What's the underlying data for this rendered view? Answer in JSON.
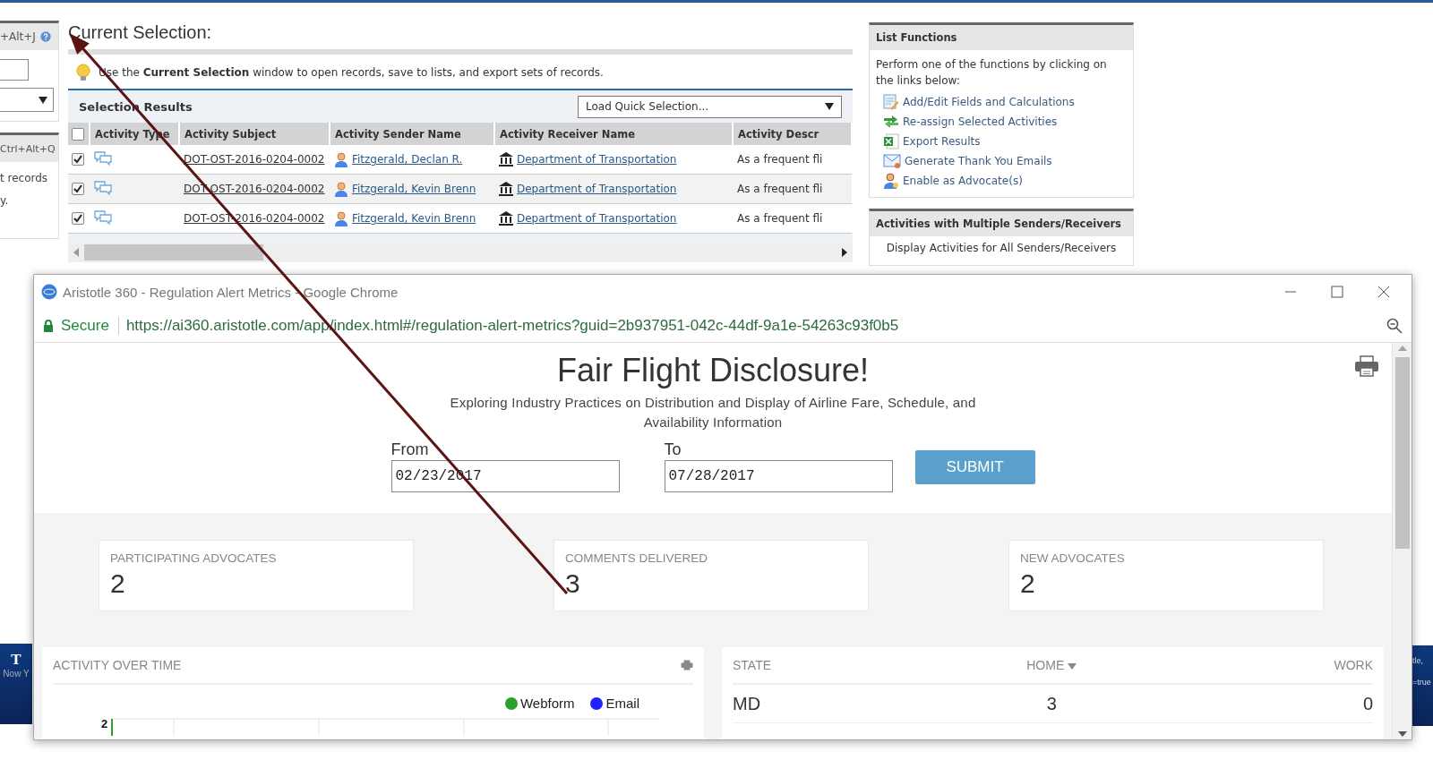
{
  "background_page": {
    "left_panel": {
      "shortcut_1": "+Alt+J",
      "shortcut_2": "Ctrl+Alt+Q",
      "text_lines": [
        "t records",
        "y."
      ]
    },
    "current_selection": {
      "title": "Current Selection:",
      "hint": "Use the **Current Selection** window to open records, save to lists, and export sets of records.",
      "results_title": "Selection Results",
      "quick_selection": "Load Quick Selection...",
      "select_all_checked": false,
      "columns": [
        "Activity Type",
        "Activity Subject",
        "Activity Sender Name",
        "Activity Receiver Name",
        "Activity Descr"
      ],
      "rows": [
        {
          "checked": true,
          "subject": "DOT-OST-2016-0204-0002",
          "sender": "Fitzgerald, Declan R.",
          "receiver": "Department of Transportation",
          "description": "As a frequent fli"
        },
        {
          "checked": true,
          "subject": "DOT-OST-2016-0204-0002",
          "sender": "Fitzgerald, Kevin Brenn",
          "receiver": "Department of Transportation",
          "description": "As a frequent fli"
        },
        {
          "checked": true,
          "subject": "DOT-OST-2016-0204-0002",
          "sender": "Fitzgerald, Kevin Brenn",
          "receiver": "Department of Transportation",
          "description": "As a frequent fli"
        }
      ]
    },
    "list_functions": {
      "title": "List Functions",
      "intro": "Perform one of the functions by clicking on the links below:",
      "links": [
        {
          "kind": "fields",
          "label": "Add/Edit Fields and Calculations"
        },
        {
          "kind": "reassign",
          "label": "Re-assign Selected Activities"
        },
        {
          "kind": "export",
          "label": "Export Results"
        },
        {
          "kind": "email",
          "label": "Generate Thank You Emails"
        },
        {
          "kind": "advocate",
          "label": "Enable as Advocate(s)"
        }
      ]
    },
    "multiple_panel": {
      "title": "Activities with Multiple Senders/Receivers",
      "link": "Display Activities for All Senders/Receivers"
    },
    "left_banner": {
      "letter": "T",
      "text": "Now Y"
    },
    "right_banner": {
      "lines": [
        "tle,",
        "=true"
      ]
    }
  },
  "browser_window": {
    "title": "Aristotle 360 - Regulation Alert Metrics - Google Chrome",
    "secure_label": "Secure",
    "url": "https://ai360.aristotle.com/app/index.html#/regulation-alert-metrics?guid=2b937951-042c-44df-9a1e-54263c93f0b5",
    "page": {
      "title": "Fair Flight Disclosure!",
      "subtitle": "Exploring Industry Practices on Distribution and Display of Airline Fare, Schedule, and Availability Information",
      "from_label": "From",
      "from_value": "02/23/2017",
      "to_label": "To",
      "to_value": "07/28/2017",
      "submit": "SUBMIT",
      "stats": [
        {
          "label": "PARTICIPATING ADVOCATES",
          "value": "2"
        },
        {
          "label": "COMMENTS DELIVERED",
          "value": "3"
        },
        {
          "label": "NEW ADVOCATES",
          "value": "2"
        }
      ],
      "activity_card": {
        "title": "ACTIVITY OVER TIME",
        "y_tick": "2",
        "legend": [
          {
            "label": "Webform",
            "color": "#2ca02c"
          },
          {
            "label": "Email",
            "color": "#2222ff"
          }
        ]
      },
      "state_table": {
        "columns": [
          {
            "label": "STATE",
            "sorted": false
          },
          {
            "label": "HOME",
            "sorted": true
          },
          {
            "label": "WORK",
            "sorted": false
          }
        ],
        "rows": [
          [
            "MD",
            "3",
            "0"
          ]
        ]
      }
    }
  }
}
